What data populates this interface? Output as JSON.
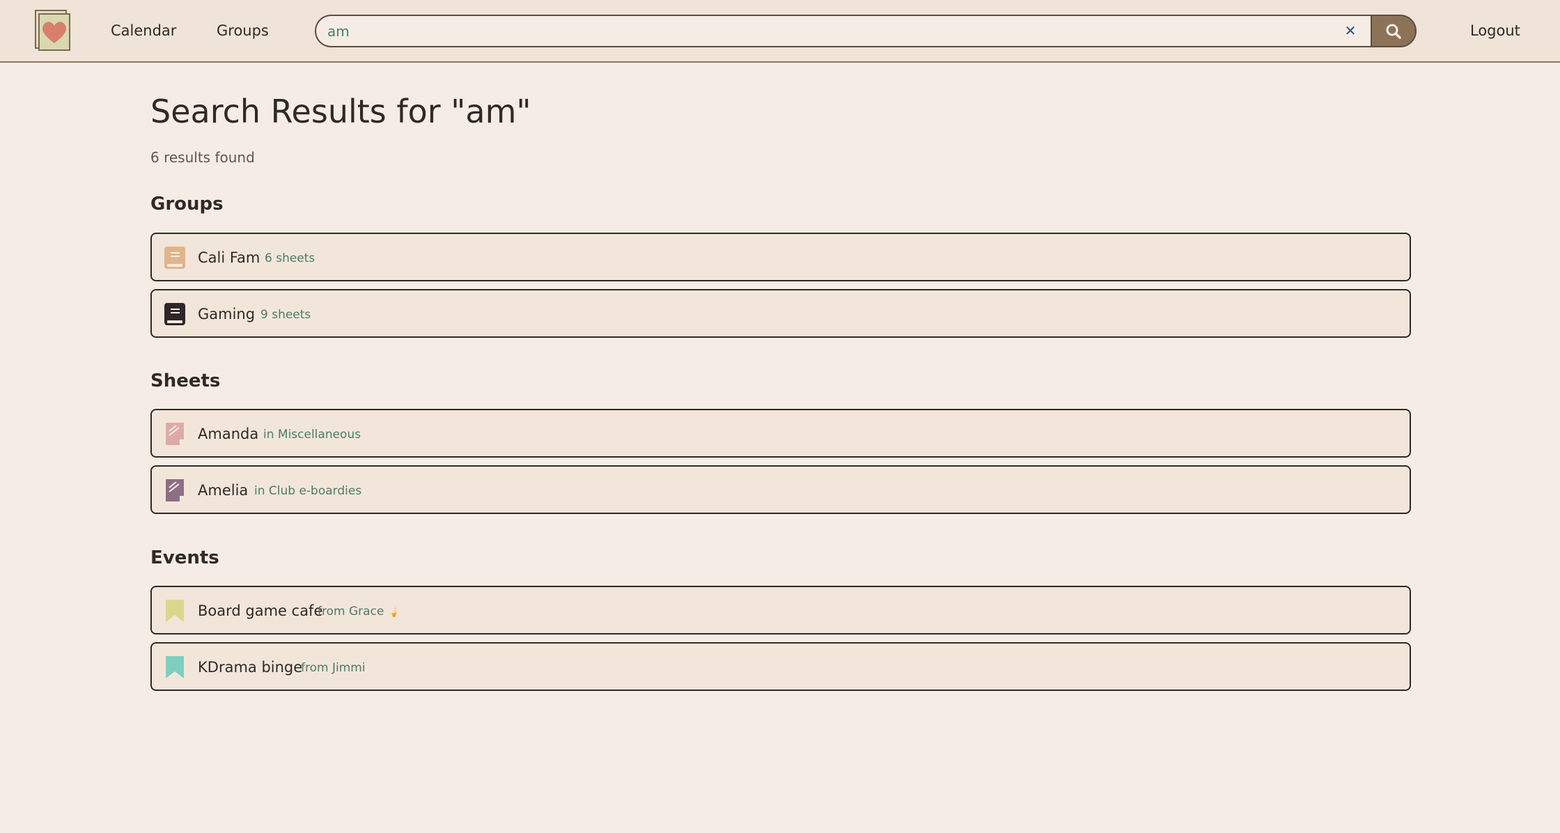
{
  "nav": {
    "calendar_label": "Calendar",
    "groups_label": "Groups",
    "logout_label": "Logout"
  },
  "search": {
    "value": "am",
    "clear_glyph": "✕"
  },
  "page": {
    "title": "Search Results for \"am\"",
    "result_count": "6 results found"
  },
  "sections": {
    "groups": {
      "heading": "Groups",
      "items": [
        {
          "title": "Cali Fam",
          "meta": "6 sheets",
          "icon": "book-icon",
          "color": "#e2b48a"
        },
        {
          "title": "Gaming",
          "meta": "9 sheets",
          "icon": "book-icon",
          "color": "#2e2628"
        }
      ]
    },
    "sheets": {
      "heading": "Sheets",
      "items": [
        {
          "title": "Amanda",
          "meta": "in Miscellaneous",
          "icon": "sheet-icon",
          "color": "#e0a9a8"
        },
        {
          "title": "Amelia",
          "meta": "in Club e-boardies",
          "icon": "sheet-icon",
          "color": "#8e6e86"
        }
      ]
    },
    "events": {
      "heading": "Events",
      "items": [
        {
          "title": "Board game cafe",
          "meta": "from Grace",
          "emoji": "🍦",
          "icon": "bookmark-icon",
          "color": "#d9d88a"
        },
        {
          "title": "KDrama binge",
          "meta": "from Jimmi",
          "icon": "bookmark-icon",
          "color": "#7fcfc0"
        }
      ]
    }
  },
  "colors": {
    "background": "#f5ede5",
    "topbar": "#efe4d7",
    "accent": "#8c7358",
    "meta_text": "#4f7a68",
    "clear_icon": "#2d4f7e"
  }
}
